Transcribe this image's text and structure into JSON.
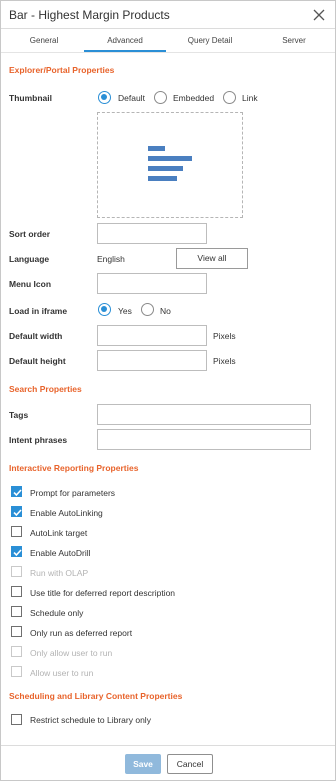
{
  "dialog": {
    "title": "Bar - Highest Margin Products",
    "close_icon": "close-icon"
  },
  "tabs": [
    {
      "label": "General"
    },
    {
      "label": "Advanced",
      "active": true
    },
    {
      "label": "Query Detail"
    },
    {
      "label": "Server"
    }
  ],
  "explorer": {
    "heading": "Explorer/Portal Properties",
    "thumbnail_label": "Thumbnail",
    "thumbnail_options": [
      "Default",
      "Embedded",
      "Link"
    ],
    "thumbnail_selected": "Default",
    "thumbnail_preview_icon": "horizontal-bar-chart-icon",
    "sort_order_label": "Sort order",
    "sort_order_value": "",
    "language_label": "Language",
    "language_value": "English",
    "view_all_label": "View all",
    "menu_icon_label": "Menu Icon",
    "menu_icon_value": "",
    "load_iframe_label": "Load in iframe",
    "load_iframe_options": [
      "Yes",
      "No"
    ],
    "load_iframe_selected": "Yes",
    "default_width_label": "Default width",
    "default_width_value": "",
    "default_width_unit": "Pixels",
    "default_height_label": "Default height",
    "default_height_value": "",
    "default_height_unit": "Pixels"
  },
  "search": {
    "heading": "Search Properties",
    "tags_label": "Tags",
    "tags_value": "",
    "intent_label": "Intent phrases",
    "intent_value": ""
  },
  "interactive": {
    "heading": "Interactive Reporting Properties",
    "options": [
      {
        "label": "Prompt for parameters",
        "checked": true,
        "disabled": false
      },
      {
        "label": "Enable AutoLinking",
        "checked": true,
        "disabled": false
      },
      {
        "label": "AutoLink target",
        "checked": false,
        "disabled": false
      },
      {
        "label": "Enable AutoDrill",
        "checked": true,
        "disabled": false
      },
      {
        "label": "Run with OLAP",
        "checked": false,
        "disabled": true
      },
      {
        "label": "Use title for deferred report description",
        "checked": false,
        "disabled": false
      },
      {
        "label": "Schedule only",
        "checked": false,
        "disabled": false
      },
      {
        "label": "Only run as deferred report",
        "checked": false,
        "disabled": false
      },
      {
        "label": "Only allow user to run",
        "checked": false,
        "disabled": true
      },
      {
        "label": "Allow user to run",
        "checked": false,
        "disabled": true
      }
    ]
  },
  "scheduling": {
    "heading": "Scheduling and Library Content Properties",
    "options": [
      {
        "label": "Restrict schedule to Library only",
        "checked": false,
        "disabled": false
      }
    ]
  },
  "footer": {
    "save_label": "Save",
    "cancel_label": "Cancel"
  },
  "colors": {
    "accent": "#2a8fd6",
    "section_heading": "#e8632b",
    "save_button": "#90b9dc"
  }
}
